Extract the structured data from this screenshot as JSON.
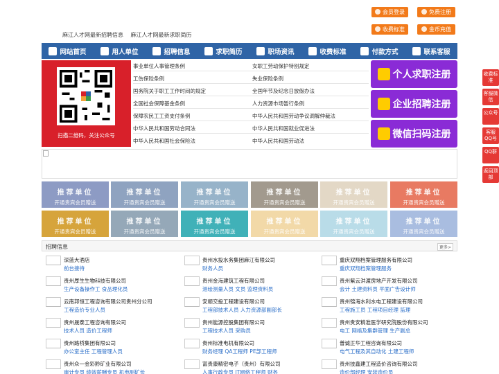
{
  "top_buttons": [
    {
      "label": "会员登录",
      "icon": "user-icon"
    },
    {
      "label": "免费注册",
      "icon": "register-icon"
    },
    {
      "label": "收费标准",
      "icon": "price-icon"
    },
    {
      "label": "金币充值",
      "icon": "coin-icon"
    }
  ],
  "top_links": [
    "麻江人才网最新招聘信息",
    "麻江人才网最新求职简历"
  ],
  "nav": [
    {
      "label": "网站首页",
      "icon": "home-icon"
    },
    {
      "label": "用人单位",
      "icon": "building-icon"
    },
    {
      "label": "招聘信息",
      "icon": "recruit-icon"
    },
    {
      "label": "求职简历",
      "icon": "resume-icon"
    },
    {
      "label": "职场资讯",
      "icon": "news-icon"
    },
    {
      "label": "收费标准",
      "icon": "fee-icon"
    },
    {
      "label": "付款方式",
      "icon": "payment-icon"
    },
    {
      "label": "联系客服",
      "icon": "service-icon"
    }
  ],
  "qr_caption": "扫描二维码，关注公众号",
  "policies": [
    [
      "事业单位人事管理条例",
      "女职工劳动保护特别规定"
    ],
    [
      "工伤保险条例",
      "失业保险条例"
    ],
    [
      "国务院关于职工工作时间的规定",
      "全国年节及纪念日放假办法"
    ],
    [
      "全国社会保障基金条例",
      "人力资源市场暂行条例"
    ],
    [
      "保障农民工工资支付条例",
      "中华人民共和国劳动争议调解仲裁法"
    ],
    [
      "中华人民共和国劳动合同法",
      "中华人民共和国就业促进法"
    ],
    [
      "中华人民共和国社会保险法",
      "中华人民共和国劳动法"
    ]
  ],
  "register": [
    {
      "label": "个人求职注册",
      "icon": "person-icon"
    },
    {
      "label": "企业招聘注册",
      "icon": "company-icon"
    },
    {
      "label": "微信扫码注册",
      "icon": "wechat-icon"
    }
  ],
  "tile_text": {
    "line1": "推荐单位",
    "line2": "开通贵宾会员赠送"
  },
  "tile_colors": [
    "#8d9bc4",
    "#8fa3c0",
    "#97b3c9",
    "#a29a8e",
    "#e3d8c6",
    "#e87a62",
    "#d6a43b",
    "#95a8b8",
    "#40b1b8",
    "#f2d9a8",
    "#b9dce8",
    "#a9bde0"
  ],
  "jobs_section": {
    "title": "招聘信息",
    "more": "更多>"
  },
  "jobs": [
    {
      "company": "深蓝大酒店",
      "positions": "前台接待"
    },
    {
      "company": "贵州水投水务集团麻江有限公司",
      "positions": "财务人员"
    },
    {
      "company": "重庆双翔档案管理服务有限公司",
      "positions": "重庆双翔档案管理服务"
    },
    {
      "company": "贵州厚生生物科技有限公司",
      "positions": "生产设备操作工 食品理化员"
    },
    {
      "company": "贵州金海建筑工程有限公司",
      "positions": "测绘测量人员 文员 监理资料员"
    },
    {
      "company": "贵州紫云洪渡房地产开发有限公司",
      "positions": "会计 土建资料员 平面广告设计师"
    },
    {
      "company": "云南邦恒工程咨询有限公司贵州分公司",
      "positions": "工程造价专业人员"
    },
    {
      "company": "安顺交投工程建设有限公司",
      "positions": "工程部技术人员 人力资源部副部长"
    },
    {
      "company": "贵州锦海水利水电工程建设有限公司",
      "positions": "工程施工员 工程项目经理 监理"
    },
    {
      "company": "贵州晟泰工程咨询有限公司",
      "positions": "技术人员 造价工程师"
    },
    {
      "company": "贵州能源控股集团有限公司",
      "positions": "工程技术人员 采购员"
    },
    {
      "company": "贵州贵安精准医学研究院股份有限公司",
      "positions": "电工 网络及集群管理 生产副总"
    },
    {
      "company": "贵州路桥集团有限公司",
      "positions": "办公室主任 工程管理人员"
    },
    {
      "company": "贵州标准电机有限公司",
      "positions": "财务经理 QA工程师 PE部工程师"
    },
    {
      "company": "普诚正华工程咨询有限公司",
      "positions": "电气工程及其自动化 土建工程师"
    },
    {
      "company": "贵州众一金彩黔矿业有限公司",
      "positions": "审计专员 绩效薪酬专员 机电副矿长"
    },
    {
      "company": "富贵康精密电子（贵州）有限公司",
      "positions": "人事行政专员 IT网络工程师 财务"
    },
    {
      "company": "贵州技鑫建工程造价咨询有限公司",
      "positions": "造价部经理 安装造价员"
    }
  ],
  "side_buttons": [
    "收费标准",
    "客服微信",
    "公众号",
    "客服QQ号",
    "QQ群",
    "返回顶部"
  ]
}
